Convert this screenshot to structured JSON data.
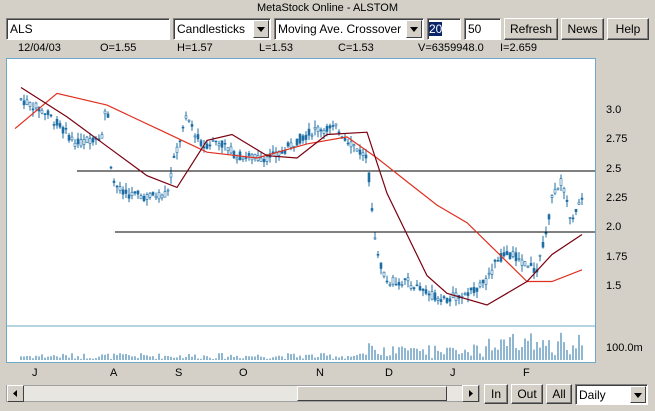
{
  "window": {
    "title": "MetaStock Online - ALSTOM"
  },
  "toolbar": {
    "symbol": "ALS",
    "chart_type": "Candlesticks",
    "indicator": "Moving Ave. Crossover",
    "period_fast": "20",
    "period_slow": "50",
    "refresh_label": "Refresh",
    "news_label": "News",
    "help_label": "Help"
  },
  "quote": {
    "date": "12/04/03",
    "open": "O=1.55",
    "high": "H=1.57",
    "low": "L=1.53",
    "close": "C=1.53",
    "volume": "V=6359948.0",
    "indicator": "I=2.659"
  },
  "axes": {
    "y_ticks": [
      "3.0",
      "2.75",
      "2.5",
      "2.25",
      "2.0",
      "1.75",
      "1.5"
    ],
    "volume_label": "100.0m",
    "x_ticks": [
      "J",
      "A",
      "S",
      "O",
      "N",
      "D",
      "J",
      "F"
    ]
  },
  "bottom": {
    "in_label": "In",
    "out_label": "Out",
    "all_label": "All",
    "period": "Daily"
  },
  "colors": {
    "candles": "#1f6fa6",
    "ma_fast": "#7a0010",
    "ma_slow": "#e03020",
    "hline": "#000000",
    "frame": "#6fa8c8"
  }
}
